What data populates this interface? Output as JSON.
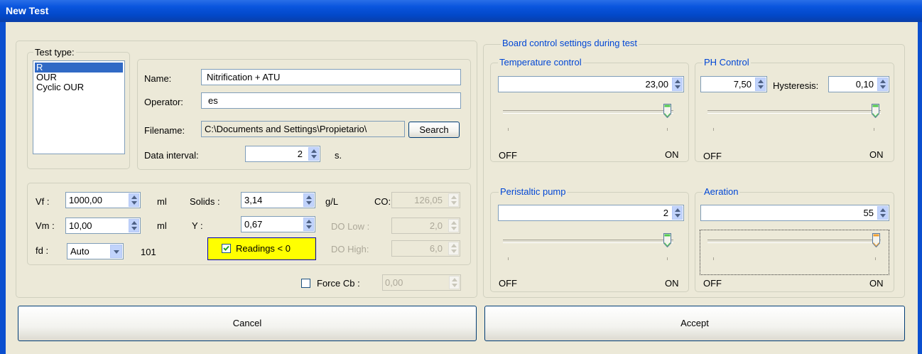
{
  "window": {
    "title": "New Test"
  },
  "test_type": {
    "legend": "Test type:",
    "options": [
      "R",
      "OUR",
      "Cyclic OUR"
    ],
    "selected": "R"
  },
  "details": {
    "name_label": "Name:",
    "name_value": "Nitrification + ATU",
    "operator_label": "Operator:",
    "operator_value": "es",
    "filename_label": "Filename:",
    "filename_value": "C:\\Documents and Settings\\Propietario\\",
    "search_label": "Search",
    "interval_label": "Data interval:",
    "interval_value": "2",
    "interval_unit": "s."
  },
  "params": {
    "vf_label": "Vf :",
    "vf_value": "1000,00",
    "vf_unit": "ml",
    "vm_label": "Vm :",
    "vm_value": "10,00",
    "vm_unit": "ml",
    "fd_label": "fd :",
    "fd_value": "Auto",
    "fd_extra": "101",
    "solids_label": "Solids :",
    "solids_value": "3,14",
    "solids_unit": "g/L",
    "y_label": "Y :",
    "y_value": "0,67",
    "co_label": "CO:",
    "co_value": "126,05",
    "do_low_label": "DO Low :",
    "do_low_value": "2,0",
    "do_high_label": "DO High:",
    "do_high_value": "6,0",
    "readings_label": "Readings < 0",
    "readings_checked": true,
    "force_cb_label": "Force Cb :",
    "force_cb_value": "0,00",
    "force_cb_checked": false
  },
  "board": {
    "legend": "Board control settings during test",
    "temperature": {
      "legend": "Temperature control",
      "value": "23,00",
      "level": 1.0,
      "off": "OFF",
      "on": "ON"
    },
    "ph": {
      "legend": "PH Control",
      "value": "7,50",
      "hyst_label": "Hysteresis:",
      "hyst_value": "0,10",
      "level": 1.0,
      "off": "OFF",
      "on": "ON"
    },
    "pump": {
      "legend": "Peristaltic pump",
      "value": "2",
      "level": 1.0,
      "off": "OFF",
      "on": "ON"
    },
    "aeration": {
      "legend": "Aeration",
      "value": "55",
      "level": 1.0,
      "off": "OFF",
      "on": "ON"
    }
  },
  "buttons": {
    "cancel": "Cancel",
    "accept": "Accept"
  },
  "colors": {
    "title_bar": "#0a55de",
    "highlight": "#ffff00",
    "legend_blue": "#0046d5",
    "thumb_green": "#4fc84a",
    "thumb_orange": "#f0a030"
  }
}
